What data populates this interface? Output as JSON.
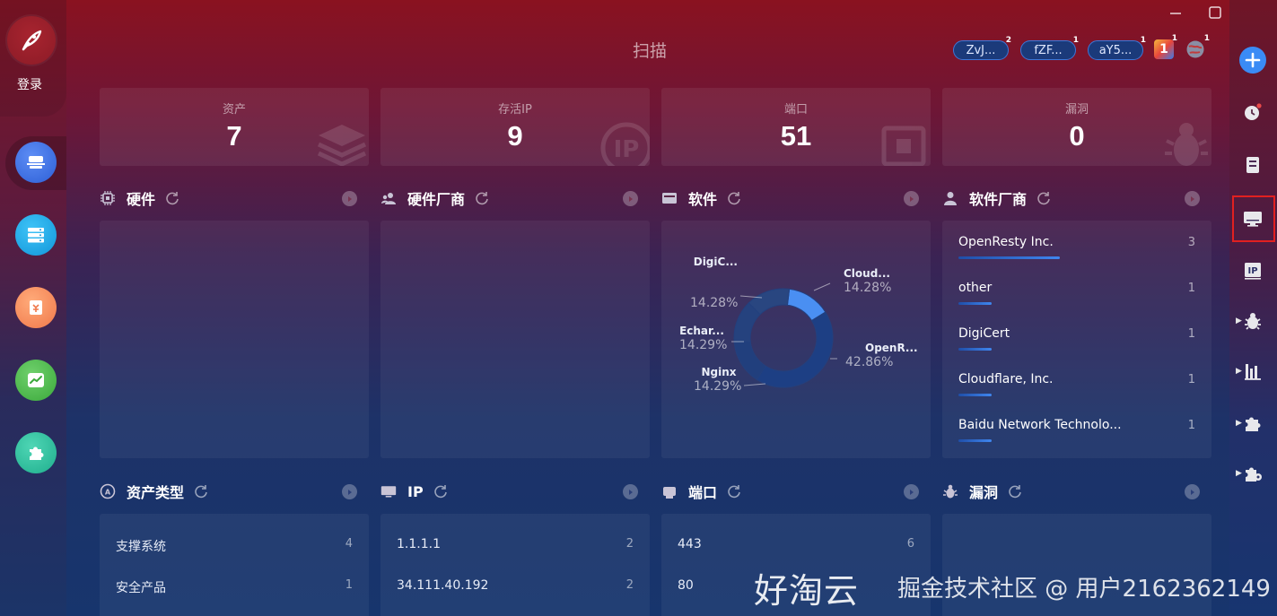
{
  "sidebar": {
    "login_label": "登录"
  },
  "window": {
    "title": "扫描"
  },
  "tags": [
    {
      "label": "ZvJ...",
      "count": "2"
    },
    {
      "label": "fZF...",
      "count": "1"
    },
    {
      "label": "aY5...",
      "count": "1"
    },
    {
      "label": "1",
      "count": "1"
    }
  ],
  "stats": [
    {
      "label": "资产",
      "value": "7"
    },
    {
      "label": "存活IP",
      "value": "9"
    },
    {
      "label": "端口",
      "value": "51"
    },
    {
      "label": "漏洞",
      "value": "0"
    }
  ],
  "sections_row1": [
    {
      "title": "硬件"
    },
    {
      "title": "硬件厂商"
    },
    {
      "title": "软件"
    },
    {
      "title": "软件厂商"
    }
  ],
  "software_pie": [
    {
      "name": "DigiC...",
      "percent": "14.28%"
    },
    {
      "name": "Cloud...",
      "percent": "14.28%"
    },
    {
      "name": "Echar...",
      "percent": "14.29%"
    },
    {
      "name": "OpenR...",
      "percent": "42.86%"
    },
    {
      "name": "Nginx",
      "percent": "14.29%"
    }
  ],
  "software_vendors": [
    {
      "name": "OpenResty Inc.",
      "count": "3",
      "share": 1.0
    },
    {
      "name": "other",
      "count": "1",
      "share": 0.33
    },
    {
      "name": "DigiCert",
      "count": "1",
      "share": 0.33
    },
    {
      "name": "Cloudflare, Inc.",
      "count": "1",
      "share": 0.33
    },
    {
      "name": "Baidu Network Technolo...",
      "count": "1",
      "share": 0.33
    }
  ],
  "sections_row2": [
    {
      "title": "资产类型"
    },
    {
      "title": "IP"
    },
    {
      "title": "端口"
    },
    {
      "title": "漏洞"
    }
  ],
  "asset_types": [
    {
      "name": "支撑系统",
      "count": "4"
    },
    {
      "name": "安全产品",
      "count": "1"
    }
  ],
  "ips": [
    {
      "name": "1.1.1.1",
      "count": "2"
    },
    {
      "name": "34.111.40.192",
      "count": "2"
    }
  ],
  "ports": [
    {
      "name": "443",
      "count": "6"
    },
    {
      "name": "80",
      "count": ""
    }
  ],
  "watermark": {
    "main": "好淘云",
    "overlay": "掘金技术社区 @ 用户2162362149"
  },
  "colors": {
    "accent": "#3f86ef",
    "highlight": "#e12020"
  }
}
